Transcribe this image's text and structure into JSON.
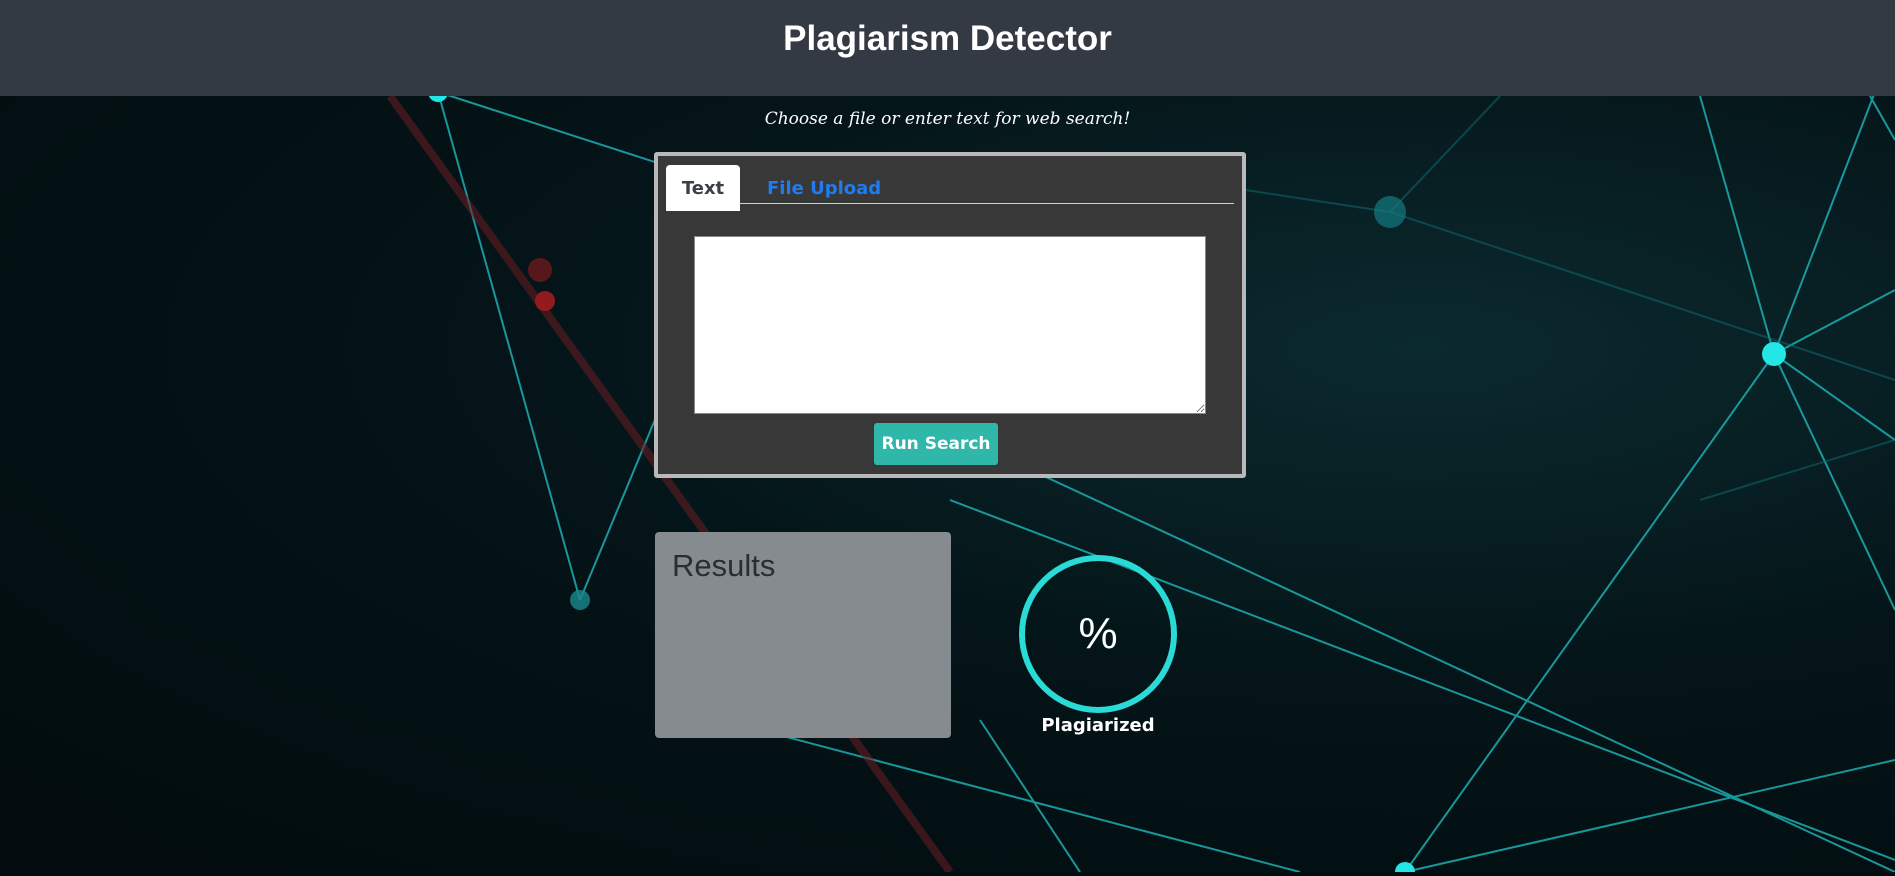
{
  "header": {
    "title": "Plagiarism Detector"
  },
  "subtitle": "Choose a file or enter text for web search!",
  "input_panel": {
    "tabs": [
      {
        "label": "Text",
        "active": true
      },
      {
        "label": "File Upload",
        "active": false
      }
    ],
    "textarea_value": "",
    "run_button_label": "Run Search"
  },
  "results": {
    "title": "Results"
  },
  "gauge": {
    "symbol": "%",
    "label": "Plagiarized"
  },
  "colors": {
    "accent": "#2adbd5",
    "button": "#2fb7aa",
    "link": "#1e7cf0",
    "header_bg": "#343a44"
  }
}
